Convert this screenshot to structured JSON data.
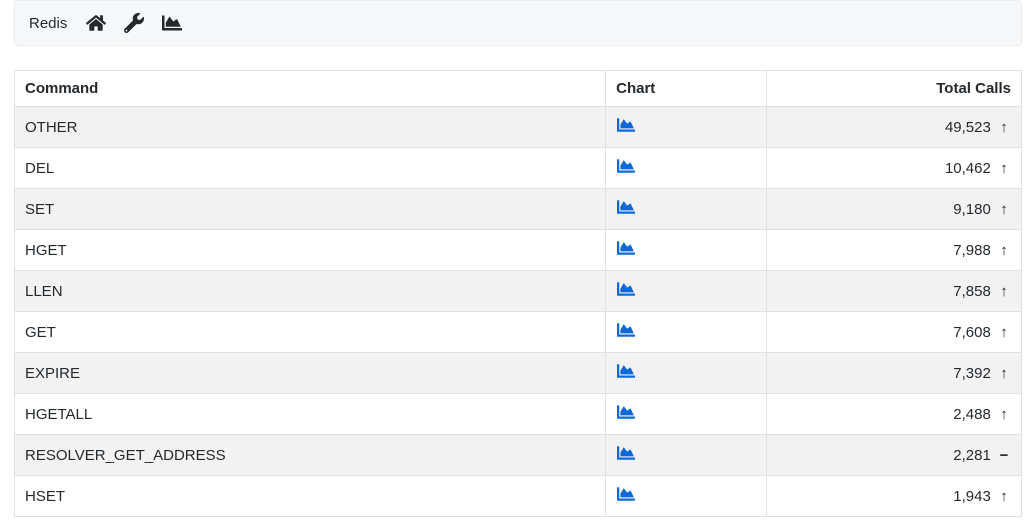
{
  "topbar": {
    "title": "Redis"
  },
  "table": {
    "headers": {
      "command": "Command",
      "chart": "Chart",
      "total_calls": "Total Calls"
    },
    "rows": [
      {
        "command": "OTHER",
        "calls": "49,523",
        "trend": "up"
      },
      {
        "command": "DEL",
        "calls": "10,462",
        "trend": "up"
      },
      {
        "command": "SET",
        "calls": "9,180",
        "trend": "up"
      },
      {
        "command": "HGET",
        "calls": "7,988",
        "trend": "up"
      },
      {
        "command": "LLEN",
        "calls": "7,858",
        "trend": "up"
      },
      {
        "command": "GET",
        "calls": "7,608",
        "trend": "up"
      },
      {
        "command": "EXPIRE",
        "calls": "7,392",
        "trend": "up"
      },
      {
        "command": "HGETALL",
        "calls": "2,488",
        "trend": "up"
      },
      {
        "command": "RESOLVER_GET_ADDRESS",
        "calls": "2,281",
        "trend": "flat"
      },
      {
        "command": "HSET",
        "calls": "1,943",
        "trend": "up"
      }
    ]
  },
  "icons": {
    "trend_up": "↑",
    "trend_flat": "−"
  }
}
